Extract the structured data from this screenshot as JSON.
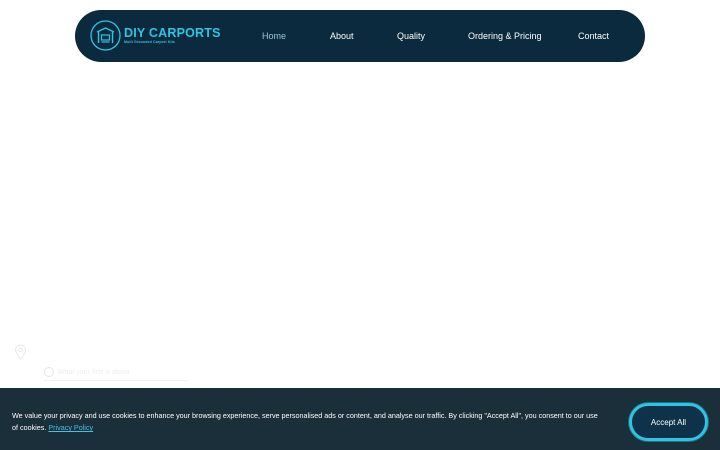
{
  "header": {
    "logo": {
      "title": "DIY CARPORTS",
      "tagline": "Multi Grounded Carport Kits",
      "icon": "carport-icon"
    },
    "nav": [
      {
        "label": "Home",
        "active": true
      },
      {
        "label": "About",
        "active": false
      },
      {
        "label": "Quality",
        "active": false
      },
      {
        "label": "Ordering & Pricing",
        "active": false
      },
      {
        "label": "Contact",
        "active": false
      }
    ]
  },
  "widget": {
    "prompt": "What your first is about"
  },
  "cookie_banner": {
    "message": "We value your privacy and use cookies to enhance your browsing experience, serve personalised ads or content, and analyse our traffic. By clicking \"Accept All\", you consent to our use of cookies.",
    "privacy_link": "Privacy Policy",
    "accept_label": "Accept All"
  },
  "colors": {
    "navbar_bg": "#0b2a3d",
    "brand_accent": "#2ec4e6",
    "active_nav": "#9cc3d6",
    "cookie_bg": "#1b2f3b",
    "button_border": "#30c3e2"
  }
}
